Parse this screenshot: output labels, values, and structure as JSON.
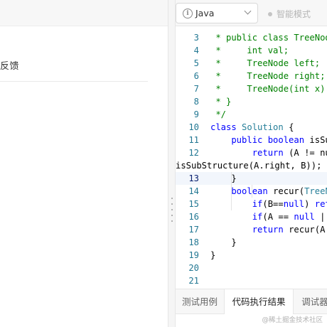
{
  "left": {
    "feedback_label": "反馈"
  },
  "toolbar": {
    "info_glyph": "i",
    "language": "Java",
    "smart_mode_label": "智能模式"
  },
  "editor": {
    "lines": [
      {
        "n": "3",
        "parts": [
          [
            "c-comment",
            " * public class TreeNode {"
          ]
        ]
      },
      {
        "n": "4",
        "parts": [
          [
            "c-comment",
            " *     int val;"
          ]
        ]
      },
      {
        "n": "5",
        "parts": [
          [
            "c-comment",
            " *     TreeNode left;"
          ]
        ]
      },
      {
        "n": "6",
        "parts": [
          [
            "c-comment",
            " *     TreeNode right;"
          ]
        ]
      },
      {
        "n": "7",
        "parts": [
          [
            "c-comment",
            " *     TreeNode(int x) { val = x; }"
          ]
        ]
      },
      {
        "n": "8",
        "parts": [
          [
            "c-comment",
            " * }"
          ]
        ]
      },
      {
        "n": "9",
        "parts": [
          [
            "c-comment",
            " */"
          ]
        ]
      },
      {
        "n": "10",
        "parts": [
          [
            "c-kw",
            "class "
          ],
          [
            "c-type",
            "Solution"
          ],
          [
            "c-plain",
            " {"
          ]
        ]
      },
      {
        "n": "11",
        "parts": [
          [
            "c-kw",
            "    public boolean "
          ],
          [
            "c-plain",
            "isSubStructure(TreeNode A, TreeNode B) {"
          ]
        ]
      },
      {
        "n": "12",
        "parts": [
          [
            "c-kw",
            "        return "
          ],
          [
            "c-plain",
            "(A != null && B != null) && (recur(A, B) || isSubStructure(A.left, B) ||"
          ]
        ]
      },
      {
        "n": "",
        "parts": [
          [
            "c-plain",
            "isSubStructure(A.right, B));"
          ]
        ],
        "wrap": true
      },
      {
        "n": "13",
        "parts": [
          [
            "c-plain",
            "    }"
          ]
        ],
        "active": true
      },
      {
        "n": "14",
        "parts": [
          [
            "c-kw",
            "    boolean "
          ],
          [
            "c-plain",
            "recur("
          ],
          [
            "c-type",
            "TreeNode"
          ],
          [
            "c-plain",
            " A, TreeNode B) {"
          ]
        ]
      },
      {
        "n": "15",
        "parts": [
          [
            "c-kw",
            "        if"
          ],
          [
            "c-plain",
            "(B=="
          ],
          [
            "c-kw",
            "null"
          ],
          [
            "c-plain",
            ") "
          ],
          [
            "c-kw",
            "return true"
          ],
          [
            "c-plain",
            ";"
          ]
        ]
      },
      {
        "n": "16",
        "parts": [
          [
            "c-kw",
            "        if"
          ],
          [
            "c-plain",
            "(A == "
          ],
          [
            "c-kw",
            "null"
          ],
          [
            "c-plain",
            " || A.val != B.val) return false;"
          ]
        ]
      },
      {
        "n": "17",
        "parts": [
          [
            "c-kw",
            "        return "
          ],
          [
            "c-plain",
            "recur(A.left, B.left) && recur(A.right, B.right);"
          ]
        ]
      },
      {
        "n": "18",
        "parts": [
          [
            "c-plain",
            "    }"
          ]
        ]
      },
      {
        "n": "19",
        "parts": [
          [
            "c-plain",
            "}"
          ]
        ]
      },
      {
        "n": "20",
        "parts": [
          [
            "c-plain",
            ""
          ]
        ]
      },
      {
        "n": "21",
        "parts": [
          [
            "c-plain",
            ""
          ]
        ]
      }
    ]
  },
  "tabs": [
    {
      "label": "测试用例",
      "active": false
    },
    {
      "label": "代码执行结果",
      "active": true
    },
    {
      "label": "调试器",
      "active": false
    }
  ],
  "watermark": "@稀土掘金技术社区"
}
